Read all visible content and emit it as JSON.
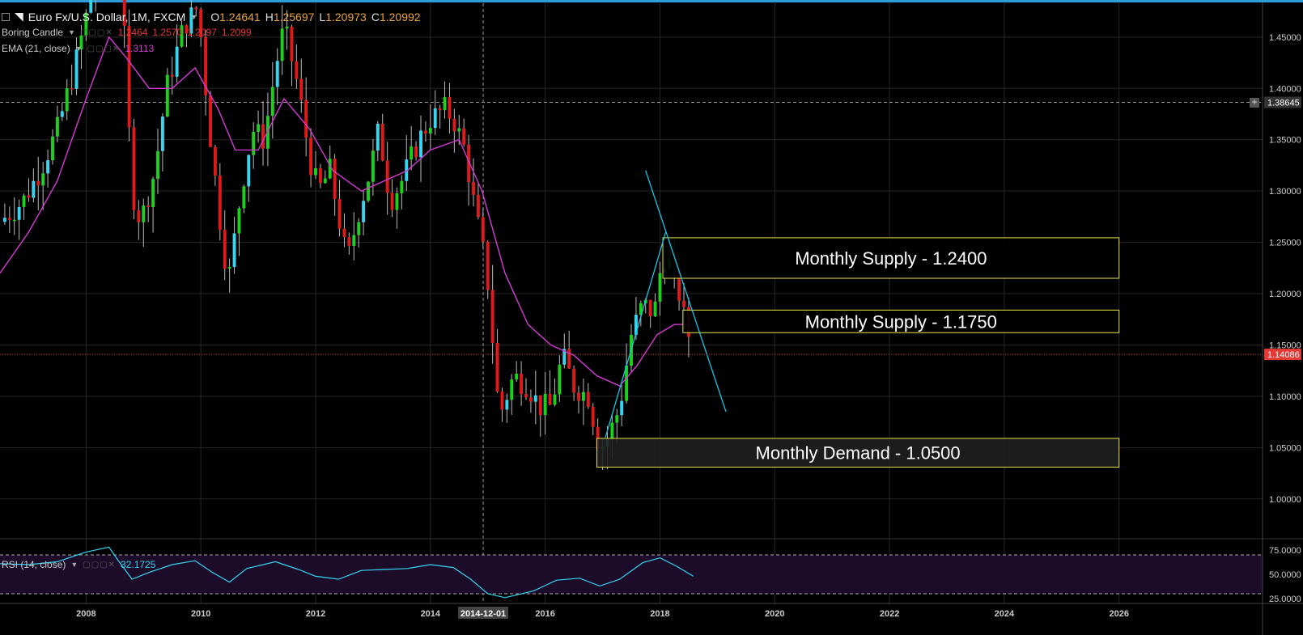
{
  "header": {
    "symbol": "Euro Fx/U.S. Dollar, 1M, FXCM",
    "o_label": "O",
    "o_value": "1.24641",
    "h_label": "H",
    "h_value": "1.25697",
    "l_label": "L",
    "l_value": "1.20973",
    "c_label": "C",
    "c_value": "1.20992"
  },
  "indicators": {
    "boring": {
      "label": "Boring Candle",
      "values": [
        "1.2464",
        "1.2570",
        "1.2097",
        "1.2099"
      ]
    },
    "ema": {
      "label": "EMA (21, close)",
      "value": "1.3113"
    },
    "rsi": {
      "label": "RSI (14, close)",
      "value": "32.1725"
    }
  },
  "crosshair": {
    "date_label": "2014-12-01",
    "price_label": "1.38645"
  },
  "current_price": "1.14086",
  "colors": {
    "bull": "#1bd11b",
    "bull_alt": "#35d6f0",
    "bear": "#e01a1a",
    "ema": "#d63ad6",
    "trend": "#19c6e6",
    "zone": "#e6e64a",
    "rsi": "#33d6f0",
    "accent": "#2e9cd8"
  },
  "chart_data": {
    "type": "candlestick",
    "timeframe": "1M",
    "ylim": [
      0.962,
      1.483
    ],
    "y_ticks": [
      "1.45000",
      "1.40000",
      "1.35000",
      "1.30000",
      "1.25000",
      "1.20000",
      "1.15000",
      "1.10000",
      "1.05000",
      "1.00000"
    ],
    "x_range": [
      2006.5,
      2028.5
    ],
    "x_ticks": [
      "2008",
      "2010",
      "2012",
      "2014",
      "2016",
      "2018",
      "2020",
      "2022",
      "2024",
      "2026"
    ],
    "price_path": [
      [
        2006.5,
        1.27
      ],
      [
        2006.9,
        1.29
      ],
      [
        2007.2,
        1.32
      ],
      [
        2007.5,
        1.36
      ],
      [
        2007.8,
        1.42
      ],
      [
        2008.0,
        1.47
      ],
      [
        2008.3,
        1.55
      ],
      [
        2008.55,
        1.58
      ],
      [
        2008.8,
        1.3
      ],
      [
        2008.95,
        1.27
      ],
      [
        2009.2,
        1.32
      ],
      [
        2009.4,
        1.4
      ],
      [
        2009.7,
        1.46
      ],
      [
        2009.95,
        1.48
      ],
      [
        2010.15,
        1.36
      ],
      [
        2010.4,
        1.24
      ],
      [
        2010.5,
        1.22
      ],
      [
        2010.7,
        1.3
      ],
      [
        2010.9,
        1.36
      ],
      [
        2011.1,
        1.35
      ],
      [
        2011.3,
        1.42
      ],
      [
        2011.45,
        1.46
      ],
      [
        2011.7,
        1.4
      ],
      [
        2011.9,
        1.33
      ],
      [
        2012.05,
        1.3
      ],
      [
        2012.25,
        1.32
      ],
      [
        2012.45,
        1.26
      ],
      [
        2012.55,
        1.23
      ],
      [
        2012.75,
        1.28
      ],
      [
        2012.95,
        1.32
      ],
      [
        2013.1,
        1.36
      ],
      [
        2013.3,
        1.29
      ],
      [
        2013.5,
        1.31
      ],
      [
        2013.8,
        1.35
      ],
      [
        2014.0,
        1.37
      ],
      [
        2014.25,
        1.38
      ],
      [
        2014.4,
        1.37
      ],
      [
        2014.6,
        1.34
      ],
      [
        2014.75,
        1.29
      ],
      [
        2014.92,
        1.24
      ],
      [
        2015.0,
        1.21
      ],
      [
        2015.2,
        1.08
      ],
      [
        2015.45,
        1.12
      ],
      [
        2015.7,
        1.11
      ],
      [
        2015.9,
        1.09
      ],
      [
        2016.1,
        1.09
      ],
      [
        2016.3,
        1.14
      ],
      [
        2016.5,
        1.11
      ],
      [
        2016.75,
        1.1
      ],
      [
        2016.95,
        1.05
      ],
      [
        2017.1,
        1.06
      ],
      [
        2017.3,
        1.09
      ],
      [
        2017.5,
        1.16
      ],
      [
        2017.7,
        1.19
      ],
      [
        2017.9,
        1.18
      ],
      [
        2018.05,
        1.24
      ],
      [
        2018.15,
        1.23
      ],
      [
        2018.3,
        1.21
      ],
      [
        2018.4,
        1.18
      ],
      [
        2018.5,
        1.16
      ],
      [
        2018.58,
        1.14
      ]
    ],
    "ema_path": [
      [
        2006.5,
        1.22
      ],
      [
        2007.0,
        1.26
      ],
      [
        2007.5,
        1.31
      ],
      [
        2008.0,
        1.39
      ],
      [
        2008.4,
        1.45
      ],
      [
        2008.7,
        1.43
      ],
      [
        2009.1,
        1.4
      ],
      [
        2009.5,
        1.4
      ],
      [
        2009.9,
        1.42
      ],
      [
        2010.3,
        1.38
      ],
      [
        2010.6,
        1.34
      ],
      [
        2011.0,
        1.34
      ],
      [
        2011.45,
        1.39
      ],
      [
        2011.9,
        1.36
      ],
      [
        2012.3,
        1.32
      ],
      [
        2012.8,
        1.3
      ],
      [
        2013.2,
        1.31
      ],
      [
        2013.6,
        1.32
      ],
      [
        2014.0,
        1.34
      ],
      [
        2014.5,
        1.35
      ],
      [
        2014.9,
        1.3
      ],
      [
        2015.3,
        1.22
      ],
      [
        2015.7,
        1.17
      ],
      [
        2016.1,
        1.15
      ],
      [
        2016.5,
        1.14
      ],
      [
        2016.9,
        1.12
      ],
      [
        2017.3,
        1.11
      ],
      [
        2017.6,
        1.13
      ],
      [
        2017.95,
        1.16
      ],
      [
        2018.25,
        1.17
      ],
      [
        2018.58,
        1.17
      ]
    ],
    "zones": [
      {
        "label": "Monthly Supply - 1.2400",
        "price_top": 1.2545,
        "price_bottom": 1.215,
        "x_from": 2018.05,
        "x_to": 2026.0,
        "fill": "#000000"
      },
      {
        "label": "Monthly Supply - 1.1750",
        "price_top": 1.184,
        "price_bottom": 1.162,
        "x_from": 2018.4,
        "x_to": 2026.0,
        "fill": "#000000"
      },
      {
        "label": "Monthly Demand - 1.0500",
        "price_top": 1.059,
        "price_bottom": 1.031,
        "x_from": 2016.9,
        "x_to": 2026.0,
        "fill": "#1f1f1f"
      }
    ],
    "trendlines": [
      {
        "from": [
          2017.05,
          1.06
        ],
        "to": [
          2018.1,
          1.26
        ]
      },
      {
        "from": [
          2017.75,
          1.32
        ],
        "to": [
          2019.15,
          1.085
        ]
      }
    ],
    "crosshair": {
      "x": 2014.92,
      "y": 1.38645
    },
    "current_price": 1.14086,
    "rsi": {
      "ylim": [
        20,
        85
      ],
      "levels": [
        70,
        30
      ],
      "y_ticks": [
        "75.0000",
        "50.0000",
        "25.0000"
      ],
      "path": [
        [
          2006.5,
          61
        ],
        [
          2007.0,
          60
        ],
        [
          2007.5,
          63
        ],
        [
          2008.0,
          73
        ],
        [
          2008.4,
          78
        ],
        [
          2008.55,
          65
        ],
        [
          2008.8,
          45
        ],
        [
          2009.1,
          52
        ],
        [
          2009.5,
          60
        ],
        [
          2009.9,
          64
        ],
        [
          2010.2,
          52
        ],
        [
          2010.5,
          42
        ],
        [
          2010.8,
          56
        ],
        [
          2011.3,
          63
        ],
        [
          2011.7,
          55
        ],
        [
          2012.0,
          48
        ],
        [
          2012.4,
          45
        ],
        [
          2012.8,
          54
        ],
        [
          2013.2,
          55
        ],
        [
          2013.6,
          56
        ],
        [
          2014.0,
          60
        ],
        [
          2014.4,
          57
        ],
        [
          2014.7,
          45
        ],
        [
          2015.0,
          30
        ],
        [
          2015.3,
          26
        ],
        [
          2015.8,
          33
        ],
        [
          2016.2,
          44
        ],
        [
          2016.6,
          46
        ],
        [
          2016.95,
          38
        ],
        [
          2017.3,
          45
        ],
        [
          2017.7,
          62
        ],
        [
          2018.0,
          67
        ],
        [
          2018.3,
          58
        ],
        [
          2018.58,
          48
        ]
      ]
    }
  }
}
